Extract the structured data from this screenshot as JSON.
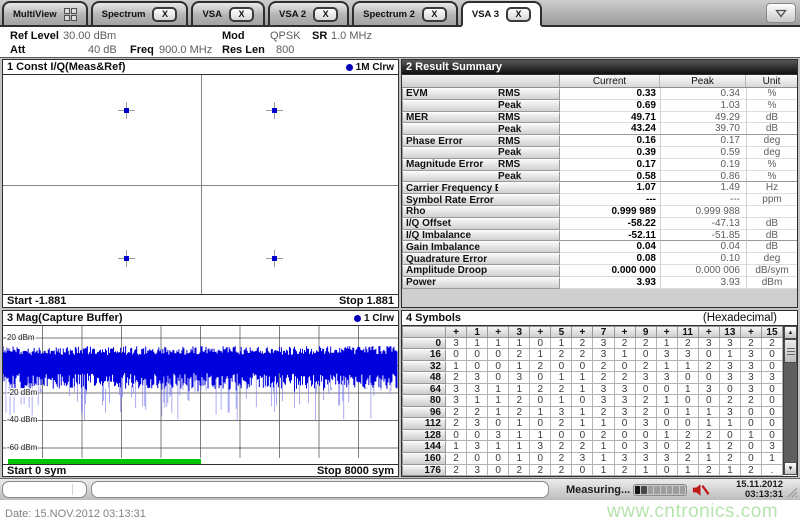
{
  "colors": {
    "trace_blue": "#0000DD",
    "marker_blue": "#0000BB",
    "green_bar": "#00C300",
    "watermark_green": "#B7E3AE",
    "alert_red": "#C11818",
    "focused_header": "#1a1a1a"
  },
  "tab_bar": {
    "close_label": "X",
    "tabs": [
      {
        "label": "MultiView",
        "icon": "grid-icon",
        "closable": false,
        "active": false
      },
      {
        "label": "Spectrum",
        "closable": true,
        "active": false
      },
      {
        "label": "VSA",
        "closable": true,
        "active": false
      },
      {
        "label": "VSA 2",
        "closable": true,
        "active": false
      },
      {
        "label": "Spectrum 2",
        "closable": true,
        "active": false
      },
      {
        "label": "VSA 3",
        "closable": true,
        "active": true
      }
    ]
  },
  "settings": {
    "ref_level": {
      "label": "Ref Level",
      "value": "30.00 dBm"
    },
    "att": {
      "label": "Att",
      "value": "40 dB"
    },
    "freq": {
      "label": "Freq",
      "value": "900.0 MHz"
    },
    "mod": {
      "label": "Mod",
      "value": "QPSK"
    },
    "sr": {
      "label": "SR",
      "value": "1.0 MHz"
    },
    "res_len": {
      "label": "Res Len",
      "value": "800"
    }
  },
  "const_window": {
    "title": "1 Const I/Q(Meas&Ref)",
    "trace_label": "1M Clrw",
    "start": "Start -1.881",
    "stop": "Stop 1.881"
  },
  "result_summary": {
    "title": "2 Result Summary",
    "columns": [
      "Current",
      "Peak",
      "Unit"
    ],
    "rows": [
      {
        "name": "EVM",
        "sub": "RMS",
        "current": "0.33",
        "peak": "0.34",
        "unit": "%"
      },
      {
        "name": "",
        "sub": "Peak",
        "current": "0.69",
        "peak": "1.03",
        "unit": "%"
      },
      {
        "name": "MER",
        "sub": "RMS",
        "current": "49.71",
        "peak": "49.29",
        "unit": "dB"
      },
      {
        "name": "",
        "sub": "Peak",
        "current": "43.24",
        "peak": "39.70",
        "unit": "dB"
      },
      {
        "name": "Phase Error",
        "sub": "RMS",
        "current": "0.16",
        "peak": "0.17",
        "unit": "deg"
      },
      {
        "name": "",
        "sub": "Peak",
        "current": "0.39",
        "peak": "0.59",
        "unit": "deg"
      },
      {
        "name": "Magnitude Error",
        "sub": "RMS",
        "current": "0.17",
        "peak": "0.19",
        "unit": "%"
      },
      {
        "name": "",
        "sub": "Peak",
        "current": "0.58",
        "peak": "0.86",
        "unit": "%"
      },
      {
        "name": "Carrier Frequency Error",
        "sub": "",
        "current": "1.07",
        "peak": "1.49",
        "unit": "Hz"
      },
      {
        "name": "Symbol Rate Error",
        "sub": "",
        "current": "---",
        "peak": "---",
        "unit": "ppm"
      },
      {
        "name": "Rho",
        "sub": "",
        "current": "0.999 989",
        "peak": "0.999 988",
        "unit": ""
      },
      {
        "name": "I/Q Offset",
        "sub": "",
        "current": "-58.22",
        "peak": "-47.13",
        "unit": "dB"
      },
      {
        "name": "I/Q Imbalance",
        "sub": "",
        "current": "-52.11",
        "peak": "-51.85",
        "unit": "dB"
      },
      {
        "name": "Gain Imbalance",
        "sub": "",
        "current": "0.04",
        "peak": "0.04",
        "unit": "dB"
      },
      {
        "name": "Quadrature Error",
        "sub": "",
        "current": "0.08",
        "peak": "0.10",
        "unit": "deg"
      },
      {
        "name": "Amplitude Droop",
        "sub": "",
        "current": "0.000 000",
        "peak": "0.000 006",
        "unit": "dB/sym"
      },
      {
        "name": "Power",
        "sub": "",
        "current": "3.93",
        "peak": "3.93",
        "unit": "dBm"
      }
    ]
  },
  "capture_window": {
    "title": "3 Mag(Capture Buffer)",
    "trace_label": "1 Clrw",
    "y_axis_labels": [
      "20 dBm",
      "-20 dBm",
      "-40 dBm",
      "-60 dBm"
    ],
    "start": "Start 0 sym",
    "stop": "Stop 8000 sym"
  },
  "symbols_window": {
    "title": "4 Symbols",
    "subtitle": "(Hexadecimal)",
    "col_headers": [
      "+",
      "1",
      "+",
      "3",
      "+",
      "5",
      "+",
      "7",
      "+",
      "9",
      "+",
      "11",
      "+",
      "13",
      "+",
      "15"
    ],
    "rows": [
      {
        "label": "0",
        "values": [
          "3",
          "1",
          "1",
          "1",
          "0",
          "1",
          "2",
          "3",
          "2",
          "2",
          "1",
          "2",
          "3",
          "3",
          "2",
          "2"
        ]
      },
      {
        "label": "16",
        "values": [
          "0",
          "0",
          "0",
          "2",
          "1",
          "2",
          "2",
          "3",
          "1",
          "0",
          "3",
          "3",
          "0",
          "1",
          "3",
          "0"
        ]
      },
      {
        "label": "32",
        "values": [
          "1",
          "0",
          "0",
          "1",
          "2",
          "0",
          "0",
          "2",
          "0",
          "2",
          "1",
          "1",
          "2",
          "3",
          "3",
          "0"
        ]
      },
      {
        "label": "48",
        "values": [
          "2",
          "3",
          "0",
          "3",
          "0",
          "1",
          "1",
          "2",
          "2",
          "3",
          "3",
          "0",
          "0",
          "3",
          "3",
          "3"
        ]
      },
      {
        "label": "64",
        "values": [
          "3",
          "3",
          "1",
          "1",
          "2",
          "2",
          "1",
          "3",
          "3",
          "0",
          "0",
          "1",
          "3",
          "0",
          "3",
          "0"
        ]
      },
      {
        "label": "80",
        "values": [
          "3",
          "1",
          "1",
          "2",
          "0",
          "1",
          "0",
          "3",
          "3",
          "2",
          "1",
          "0",
          "0",
          "2",
          "2",
          "0"
        ]
      },
      {
        "label": "96",
        "values": [
          "2",
          "2",
          "1",
          "2",
          "1",
          "3",
          "1",
          "2",
          "3",
          "2",
          "0",
          "1",
          "1",
          "3",
          "0",
          "0"
        ]
      },
      {
        "label": "112",
        "values": [
          "2",
          "3",
          "0",
          "1",
          "0",
          "2",
          "1",
          "1",
          "0",
          "3",
          "0",
          "0",
          "1",
          "1",
          "0",
          "0"
        ]
      },
      {
        "label": "128",
        "values": [
          "0",
          "0",
          "3",
          "1",
          "1",
          "0",
          "0",
          "2",
          "0",
          "0",
          "1",
          "2",
          "2",
          "0",
          "1",
          "0"
        ]
      },
      {
        "label": "144",
        "values": [
          "1",
          "3",
          "1",
          "1",
          "3",
          "2",
          "2",
          "1",
          "0",
          "3",
          "0",
          "2",
          "1",
          "2",
          "0",
          "3"
        ]
      },
      {
        "label": "160",
        "values": [
          "2",
          "0",
          "0",
          "1",
          "0",
          "2",
          "3",
          "1",
          "3",
          "3",
          "3",
          "2",
          "1",
          "2",
          "0",
          "1"
        ]
      },
      {
        "label": "176",
        "values": [
          "2",
          "3",
          "0",
          "2",
          "2",
          "2",
          "0",
          "1",
          "2",
          "1",
          "0",
          "1",
          "2",
          "1",
          "2",
          "."
        ]
      }
    ]
  },
  "status_bar": {
    "measuring": "Measuring...",
    "date": "15.11.2012",
    "time": "03:13:31",
    "progress": {
      "segments": 8,
      "filled": 2
    }
  },
  "caption": {
    "date_line": "Date: 15.NOV.2012  03:13:31"
  },
  "watermark": "www.cntronics.com",
  "chart_data": [
    {
      "type": "scatter",
      "title": "Const I/Q(Meas&Ref)",
      "trace": "1M Clrw",
      "xlim": [
        -1.881,
        1.881
      ],
      "points": [
        {
          "i": -0.707,
          "q": 0.707
        },
        {
          "i": 0.707,
          "q": 0.707
        },
        {
          "i": -0.707,
          "q": -0.707
        },
        {
          "i": 0.707,
          "q": -0.707
        }
      ]
    },
    {
      "type": "line",
      "title": "Mag(Capture Buffer)",
      "trace": "1 Clrw",
      "xlabel": "sym",
      "x_range_sym": [
        0,
        8000
      ],
      "y_gridlines_dbm": [
        20,
        0,
        -20,
        -40,
        -60
      ],
      "signal_band_dbm": [
        12,
        -15
      ],
      "spikes_down_to_dbm": -40,
      "analyzed_region_fraction": 0.49,
      "grid": true
    }
  ]
}
